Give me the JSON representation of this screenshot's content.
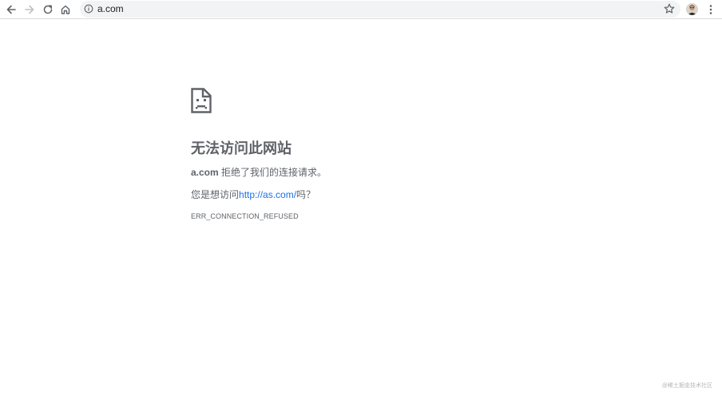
{
  "browser": {
    "url": "a.com",
    "icons": {
      "back": "arrow-left-icon",
      "forward": "arrow-right-icon",
      "reload": "reload-icon",
      "home": "home-icon",
      "site_info": "info-circle-icon",
      "bookmark": "star-icon",
      "profile": "avatar",
      "menu": "kebab-menu-icon"
    }
  },
  "error_page": {
    "icon": "sad-document-icon",
    "title": "无法访问此网站",
    "host": "a.com",
    "refused_text": " 拒绝了我们的连接请求。",
    "suggestion_prefix": "您是想访问",
    "suggestion_link": "http://as.com/",
    "suggestion_suffix": "吗？",
    "error_code": "ERR_CONNECTION_REFUSED"
  },
  "watermark": "@稀土掘金技术社区",
  "colors": {
    "text_gray": "#5f6368",
    "link_blue": "#1a73e8",
    "omnibox_bg": "#f1f3f4",
    "forward_disabled": "#bdc1c6"
  }
}
